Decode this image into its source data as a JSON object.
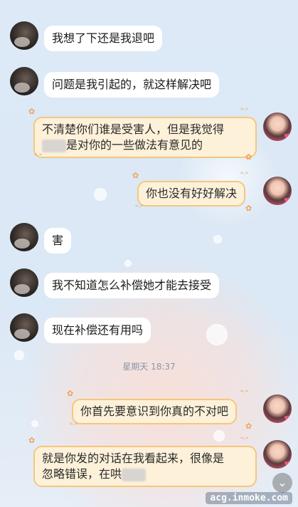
{
  "messages": [
    {
      "side": "left",
      "text": "我想了下还是我退吧"
    },
    {
      "side": "left",
      "text": "问题是我引起的，就这样解决吧"
    },
    {
      "side": "right",
      "line1": "不清楚你们谁是受害人，但是我觉得",
      "line2": "是对你的一些做法有意见的"
    },
    {
      "side": "right",
      "text": "你也没有好好解决"
    },
    {
      "side": "left",
      "text": "害"
    },
    {
      "side": "left",
      "text": "我不知道怎么补偿她才能去接受"
    },
    {
      "side": "left",
      "text": "现在补偿还有用吗"
    },
    {
      "side": "right",
      "text": "你首先要意识到你真的不对吧"
    },
    {
      "side": "right",
      "line1": "就是你发的对话在我看起来，很像是",
      "line2": "忽略错误，在哄"
    }
  ],
  "timestamp": "星期天 18:37",
  "watermark": "acg.inmoke.com",
  "icons": {
    "scroll_down": "chevron-down-icon"
  }
}
